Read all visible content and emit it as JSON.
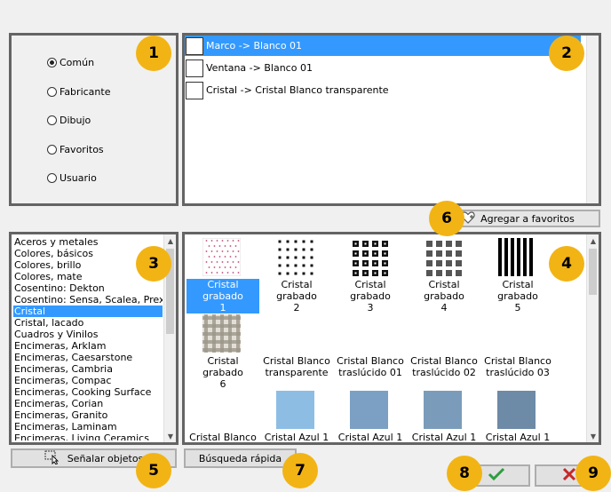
{
  "radio_options": [
    {
      "label": "Común",
      "checked": true
    },
    {
      "label": "Fabricante",
      "checked": false
    },
    {
      "label": "Dibujo",
      "checked": false
    },
    {
      "label": "Favoritos",
      "checked": false
    },
    {
      "label": "Usuario",
      "checked": false
    }
  ],
  "assignments": [
    {
      "label": "Marco -> Blanco 01",
      "selected": true
    },
    {
      "label": "Ventana -> Blanco 01",
      "selected": false
    },
    {
      "label": "Cristal -> Cristal Blanco transparente",
      "selected": false
    }
  ],
  "favorites_button": {
    "label": "Agregar a favoritos",
    "icon": "heart-plus-icon"
  },
  "categories": [
    {
      "label": "Aceros y metales",
      "selected": false
    },
    {
      "label": "Colores, básicos",
      "selected": false
    },
    {
      "label": "Colores, brillo",
      "selected": false
    },
    {
      "label": "Colores, mate",
      "selected": false
    },
    {
      "label": "Cosentino: Dekton",
      "selected": false
    },
    {
      "label": "Cosentino: Sensa, Scalea, Prexury",
      "selected": false
    },
    {
      "label": "Cristal",
      "selected": true
    },
    {
      "label": "Cristal, lacado",
      "selected": false
    },
    {
      "label": "Cuadros y Vinilos",
      "selected": false
    },
    {
      "label": "Encimeras, Arklam",
      "selected": false
    },
    {
      "label": "Encimeras, Caesarstone",
      "selected": false
    },
    {
      "label": "Encimeras, Cambria",
      "selected": false
    },
    {
      "label": "Encimeras, Compac",
      "selected": false
    },
    {
      "label": "Encimeras, Cooking Surface",
      "selected": false
    },
    {
      "label": "Encimeras, Corian",
      "selected": false
    },
    {
      "label": "Encimeras, Granito",
      "selected": false
    },
    {
      "label": "Encimeras, Laminam",
      "selected": false
    },
    {
      "label": "Encimeras, Living Ceramics",
      "selected": false
    }
  ],
  "materials": [
    {
      "label_line1": "Cristal grabado",
      "label_line2": "1",
      "pattern": "dots-fine",
      "selected": true
    },
    {
      "label_line1": "Cristal grabado",
      "label_line2": "2",
      "pattern": "dots-grid",
      "selected": false
    },
    {
      "label_line1": "Cristal grabado",
      "label_line2": "3",
      "pattern": "squares-black",
      "selected": false
    },
    {
      "label_line1": "Cristal grabado",
      "label_line2": "4",
      "pattern": "squares-gray",
      "selected": false
    },
    {
      "label_line1": "Cristal grabado",
      "label_line2": "5",
      "pattern": "stripes",
      "selected": false
    },
    {
      "label_line1": "Cristal grabado",
      "label_line2": "6",
      "pattern": "plaid",
      "selected": false
    },
    {
      "label_line1": "Cristal Blanco",
      "label_line2": "transparente",
      "pattern": "none",
      "selected": false
    },
    {
      "label_line1": "Cristal Blanco",
      "label_line2": "traslúcido 01",
      "pattern": "none",
      "selected": false
    },
    {
      "label_line1": "Cristal Blanco",
      "label_line2": "traslúcido 02",
      "pattern": "none",
      "selected": false
    },
    {
      "label_line1": "Cristal Blanco",
      "label_line2": "traslúcido 03",
      "pattern": "none",
      "selected": false
    },
    {
      "label_line1": "Cristal Blanco",
      "label_line2": "",
      "pattern": "none",
      "selected": false
    },
    {
      "label_line1": "Cristal Azul 1",
      "label_line2": "",
      "pattern": "solid",
      "color": "#8dbde3",
      "selected": false
    },
    {
      "label_line1": "Cristal Azul 1",
      "label_line2": "",
      "pattern": "solid",
      "color": "#7ba0c3",
      "selected": false
    },
    {
      "label_line1": "Cristal Azul 1",
      "label_line2": "",
      "pattern": "solid",
      "color": "#7a9cba",
      "selected": false
    },
    {
      "label_line1": "Cristal Azul 1",
      "label_line2": "",
      "pattern": "solid",
      "color": "#6d8aa6",
      "selected": false
    }
  ],
  "buttons": {
    "select_objects": "Señalar objetos",
    "quick_search": "Búsqueda rápida",
    "ok_icon": "checkmark-icon",
    "cancel_icon": "x-icon"
  },
  "badges": [
    "1",
    "2",
    "3",
    "4",
    "5",
    "6",
    "7",
    "8",
    "9"
  ],
  "colors": {
    "selection": "#3399ff",
    "badge": "#f2b414",
    "frame": "#646464",
    "ok_green": "#2e9e3e",
    "cancel_red": "#c62828"
  }
}
